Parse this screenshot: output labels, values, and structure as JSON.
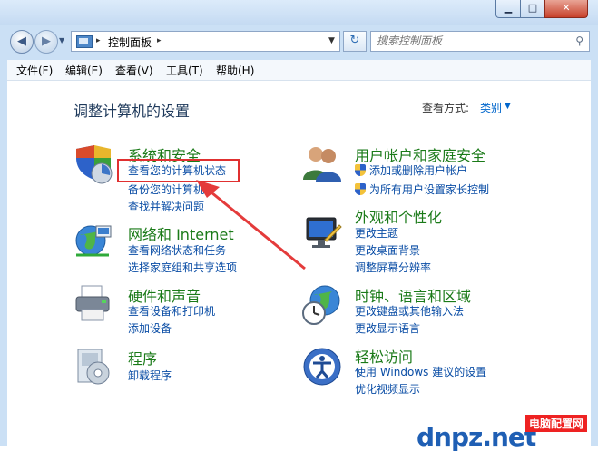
{
  "window": {
    "minimize_glyph": "▁",
    "maximize_glyph": "□",
    "close_glyph": "✕"
  },
  "nav": {
    "back_glyph": "◀",
    "forward_glyph": "▶",
    "history_glyph": "▼",
    "address_text": "控制面板",
    "address_sep": "▸",
    "address_dropdown": "▼",
    "refresh_glyph": "↻",
    "search_placeholder": "搜索控制面板",
    "search_glyph": "⚲"
  },
  "menu": {
    "items": [
      "文件(F)",
      "编辑(E)",
      "查看(V)",
      "工具(T)",
      "帮助(H)"
    ]
  },
  "page": {
    "title": "调整计算机的设置",
    "view_by_label": "查看方式:",
    "view_by_value": "类别",
    "view_by_arrow": "▼"
  },
  "categories": {
    "system": {
      "title": "系统和安全",
      "icon": "shield-icon",
      "links": [
        "查看您的计算机状态",
        "备份您的计算机",
        "查找并解决问题"
      ]
    },
    "network": {
      "title": "网络和 Internet",
      "icon": "globe-network-icon",
      "links": [
        "查看网络状态和任务",
        "选择家庭组和共享选项"
      ]
    },
    "hardware": {
      "title": "硬件和声音",
      "icon": "printer-icon",
      "links": [
        "查看设备和打印机",
        "添加设备"
      ]
    },
    "programs": {
      "title": "程序",
      "icon": "programs-icon",
      "links": [
        "卸载程序"
      ]
    },
    "users": {
      "title": "用户帐户和家庭安全",
      "icon": "users-icon",
      "links": [
        "添加或删除用户帐户",
        "为所有用户设置家长控制"
      ]
    },
    "appearance": {
      "title": "外观和个性化",
      "icon": "monitor-icon",
      "links": [
        "更改主题",
        "更改桌面背景",
        "调整屏幕分辨率"
      ]
    },
    "clock": {
      "title": "时钟、语言和区域",
      "icon": "clock-globe-icon",
      "links": [
        "更改键盘或其他输入法",
        "更改显示语言"
      ]
    },
    "ease": {
      "title": "轻松访问",
      "icon": "ease-of-access-icon",
      "links": [
        "使用 Windows 建议的设置",
        "优化视频显示"
      ]
    }
  },
  "watermark": {
    "logo": "dnpz.net",
    "brand": "电脑配置网"
  },
  "colors": {
    "category_title": "#1a7a18",
    "link": "#0a4da5",
    "highlight": "#e03030"
  }
}
